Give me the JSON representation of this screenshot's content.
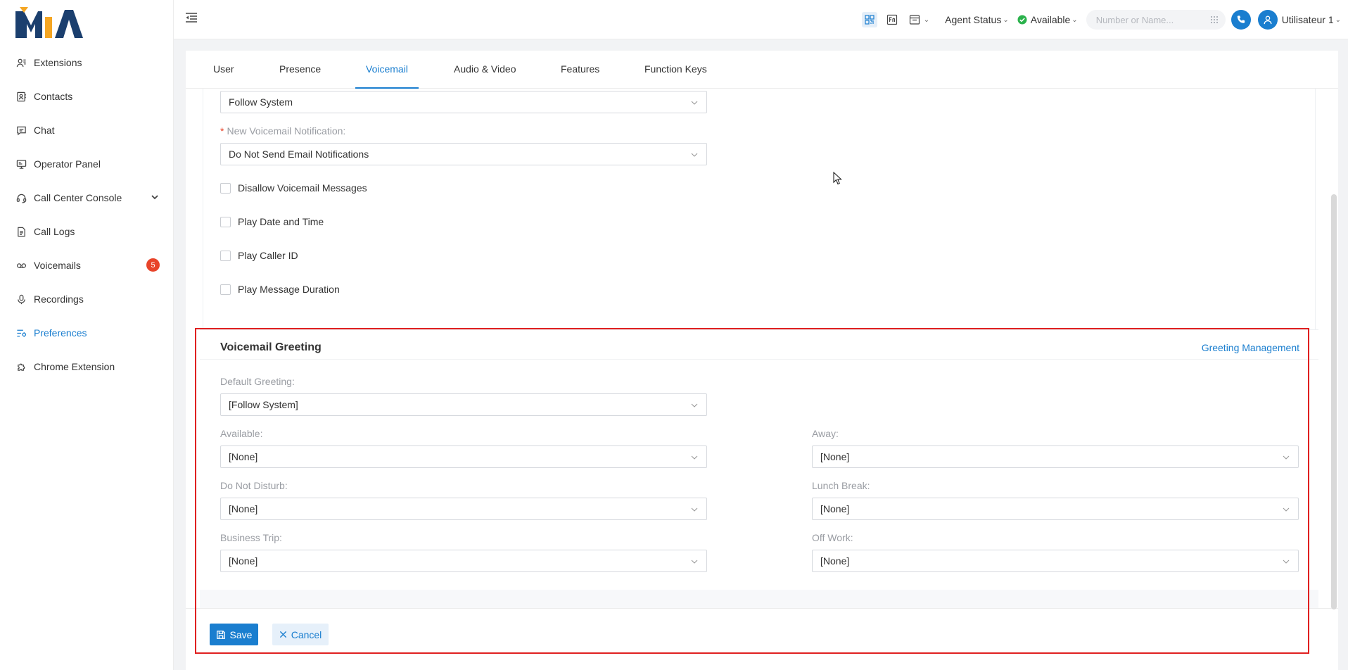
{
  "app": {
    "logo_text": "MIA"
  },
  "sidebar": {
    "items": [
      {
        "label": "Extensions",
        "icon": "users-icon"
      },
      {
        "label": "Contacts",
        "icon": "contacts-icon"
      },
      {
        "label": "Chat",
        "icon": "chat-icon"
      },
      {
        "label": "Operator Panel",
        "icon": "monitor-icon"
      },
      {
        "label": "Call Center Console",
        "icon": "headset-icon"
      },
      {
        "label": "Call Logs",
        "icon": "call-log-icon"
      },
      {
        "label": "Voicemails",
        "icon": "voicemail-icon",
        "badge": "5"
      },
      {
        "label": "Recordings",
        "icon": "microphone-icon"
      },
      {
        "label": "Preferences",
        "icon": "preferences-icon",
        "active": true
      },
      {
        "label": "Chrome Extension",
        "icon": "puzzle-icon"
      }
    ]
  },
  "header": {
    "agent_status_label": "Agent Status",
    "presence_label": "Available",
    "search_placeholder": "Number or Name...",
    "user_name": "Utilisateur 1"
  },
  "tabs": [
    {
      "label": "User"
    },
    {
      "label": "Presence"
    },
    {
      "label": "Voicemail",
      "active": true
    },
    {
      "label": "Audio & Video"
    },
    {
      "label": "Features"
    },
    {
      "label": "Function Keys"
    }
  ],
  "voicemail": {
    "top_select_value": "Follow System",
    "notification_label": "New Voicemail Notification",
    "notification_value": "Do Not Send Email Notifications",
    "checkboxes": [
      {
        "label": "Disallow Voicemail Messages",
        "checked": false
      },
      {
        "label": "Play Date and Time",
        "checked": false
      },
      {
        "label": "Play Caller ID",
        "checked": false
      },
      {
        "label": "Play Message Duration",
        "checked": false
      }
    ]
  },
  "greeting": {
    "title": "Voicemail Greeting",
    "management_link": "Greeting Management",
    "default_label": "Default Greeting",
    "default_value": "[Follow System]",
    "fields": {
      "available": {
        "label": "Available",
        "value": "[None]"
      },
      "away": {
        "label": "Away",
        "value": "[None]"
      },
      "dnd": {
        "label": "Do Not Disturb",
        "value": "[None]"
      },
      "lunch": {
        "label": "Lunch Break",
        "value": "[None]"
      },
      "trip": {
        "label": "Business Trip",
        "value": "[None]"
      },
      "offwork": {
        "label": "Off Work",
        "value": "[None]"
      }
    }
  },
  "actions": {
    "save": "Save",
    "cancel": "Cancel"
  },
  "colors": {
    "accent": "#1a7ecf",
    "badge": "#e8442a",
    "highlight": "#e02020",
    "available": "#2bb24c"
  }
}
